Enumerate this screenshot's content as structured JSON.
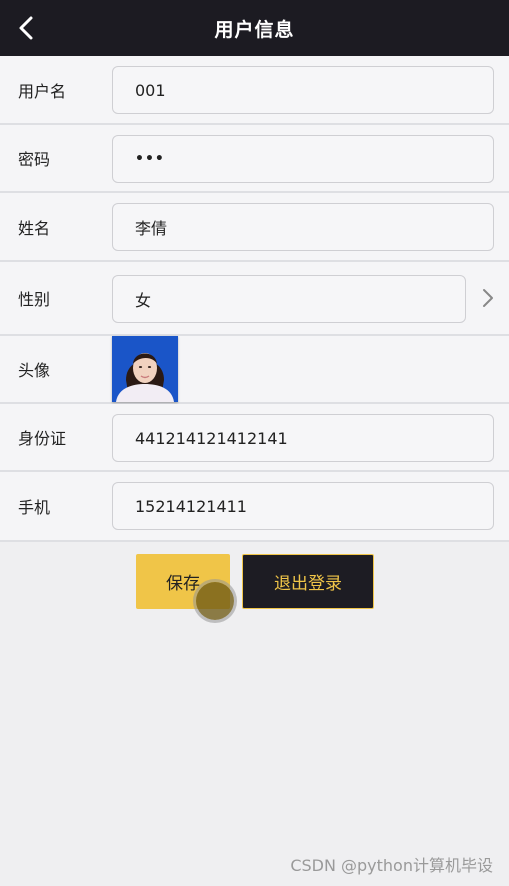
{
  "header": {
    "title": "用户信息",
    "back_icon": "chevron-left-icon"
  },
  "form": {
    "username": {
      "label": "用户名",
      "value": "001"
    },
    "password": {
      "label": "密码",
      "value": "•••"
    },
    "name": {
      "label": "姓名",
      "value": "李倩"
    },
    "gender": {
      "label": "性别",
      "value": "女",
      "icon": "chevron-right-icon"
    },
    "avatar": {
      "label": "头像"
    },
    "id_card": {
      "label": "身份证",
      "value": "441214121412141"
    },
    "phone": {
      "label": "手机",
      "value": "15214121411"
    }
  },
  "actions": {
    "save_label": "保存",
    "logout_label": "退出登录"
  },
  "watermark": "CSDN @python计算机毕设",
  "colors": {
    "header_bg": "#1c1b22",
    "accent_yellow": "#f0c548",
    "logout_bg": "#1d1c23",
    "page_bg": "#efeff1"
  }
}
